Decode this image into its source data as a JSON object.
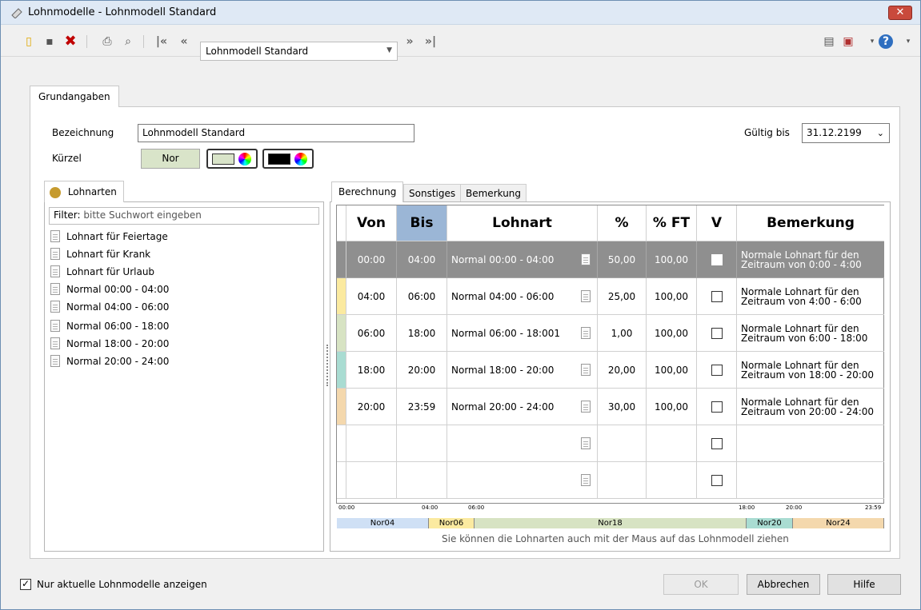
{
  "window": {
    "title": "Lohnmodelle - Lohnmodell Standard",
    "close_label": "✕"
  },
  "toolbar": {
    "nav_select": "Lohnmodell Standard",
    "icons": [
      "new-icon",
      "save-icon",
      "delete-icon",
      "print-icon",
      "preview-icon",
      "first-icon",
      "prev-icon",
      "next-icon",
      "last-icon",
      "clipboard-icon",
      "export-icon",
      "help-icon"
    ]
  },
  "main_tab": "Grundangaben",
  "form": {
    "bezeichnung_label": "Bezeichnung",
    "bezeichnung_value": "Lohnmodell Standard",
    "kuerzel_label": "Kürzel",
    "kuerzel_value": "Nor",
    "kuerzel_bg": "#d9e4c9",
    "gueltig_label": "Gültig bis",
    "gueltig_value": "31.12.2199"
  },
  "left_panel": {
    "tab": "Lohnarten",
    "filter_label": "Filter:",
    "filter_placeholder": "bitte Suchwort eingeben",
    "items": [
      "Lohnart für Feiertage",
      "Lohnart für Krank",
      "Lohnart für Urlaub",
      "Normal 00:00 - 04:00",
      "Normal 04:00 - 06:00",
      "Normal 06:00 - 18:00",
      "Normal 18:00 - 20:00",
      "Normal 20:00 - 24:00"
    ]
  },
  "right_tabs": [
    "Berechnung",
    "Sonstiges",
    "Bemerkung"
  ],
  "grid": {
    "headers": {
      "von": "Von",
      "bis": "Bis",
      "lohnart": "Lohnart",
      "pct": "%",
      "pctft": "% FT",
      "v": "V",
      "bemerkung": "Bemerkung"
    },
    "rows": [
      {
        "von": "00:00",
        "bis": "04:00",
        "lohnart": "Normal 00:00 - 04:00",
        "pct": "50,00",
        "pctft": "100,00",
        "bem1": "Normale Lohnart für den",
        "bem2": "Zeitraum von 0:00 - 4:00",
        "color": "#8f8f8f",
        "selected": true
      },
      {
        "von": "04:00",
        "bis": "06:00",
        "lohnart": "Normal 04:00 - 06:00",
        "pct": "25,00",
        "pctft": "100,00",
        "bem1": "Normale Lohnart für den",
        "bem2": "Zeitraum von 4:00 - 6:00",
        "color": "#fbeaa0",
        "selected": false
      },
      {
        "von": "06:00",
        "bis": "18:00",
        "lohnart": "Normal 06:00 - 18:001",
        "pct": "1,00",
        "pctft": "100,00",
        "bem1": "Normale Lohnart für den",
        "bem2": "Zeitraum von 6:00 - 18:00",
        "color": "#d7e3c3",
        "selected": false
      },
      {
        "von": "18:00",
        "bis": "20:00",
        "lohnart": "Normal 18:00 - 20:00",
        "pct": "20,00",
        "pctft": "100,00",
        "bem1": "Normale Lohnart für den",
        "bem2": "Zeitraum von 18:00 - 20:00",
        "color": "#a9dcd2",
        "selected": false
      },
      {
        "von": "20:00",
        "bis": "23:59",
        "lohnart": "Normal 20:00 - 24:00",
        "pct": "30,00",
        "pctft": "100,00",
        "bem1": "Normale Lohnart für den",
        "bem2": "Zeitraum von 20:00 - 24:00",
        "color": "#f4d8ad",
        "selected": false
      }
    ]
  },
  "timeline": {
    "ticks": [
      "00:00",
      "04:00",
      "06:00",
      "18:00",
      "20:00",
      "23:59"
    ],
    "segments": [
      {
        "label": "Nor04",
        "color": "#cfe0f5"
      },
      {
        "label": "Nor06",
        "color": "#fbeaa0"
      },
      {
        "label": "Nor18",
        "color": "#d7e3c3"
      },
      {
        "label": "Nor20",
        "color": "#a9dcd2"
      },
      {
        "label": "Nor24",
        "color": "#f4d8ad"
      }
    ],
    "hint": "Sie können die Lohnarten auch mit der Maus auf das Lohnmodell ziehen"
  },
  "footer": {
    "checkbox_label": "Nur aktuelle Lohnmodelle anzeigen",
    "ok": "OK",
    "cancel": "Abbrechen",
    "help": "Hilfe"
  }
}
